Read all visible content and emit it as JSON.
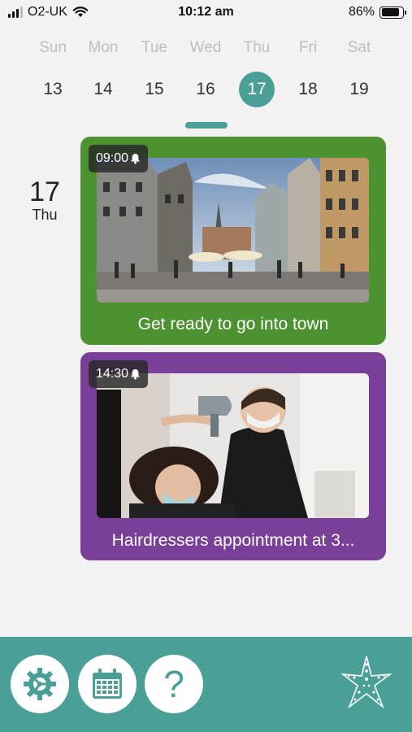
{
  "status_bar": {
    "carrier": "O2-UK",
    "time": "10:12 am",
    "battery": "86%",
    "battery_level": 0.86
  },
  "week": {
    "days": [
      {
        "name": "Sun",
        "date": "13"
      },
      {
        "name": "Mon",
        "date": "14"
      },
      {
        "name": "Tue",
        "date": "15"
      },
      {
        "name": "Wed",
        "date": "16"
      },
      {
        "name": "Thu",
        "date": "17"
      },
      {
        "name": "Fri",
        "date": "18"
      },
      {
        "name": "Sat",
        "date": "19"
      }
    ],
    "selected_index": 4
  },
  "selected_date": {
    "day": "17",
    "weekday": "Thu"
  },
  "events": [
    {
      "time": "09:00",
      "title": "Get ready to go into town",
      "color": "#4d9230",
      "image": "town-square-photo"
    },
    {
      "time": "14:30",
      "title": "Hairdressers appointment at 3...",
      "color": "#7a3f98",
      "image": "hairdresser-photo"
    }
  ],
  "bottom_bar": {
    "help_label": "?",
    "accent": "#4a9f97",
    "buttons": [
      "settings-icon",
      "calendar-icon",
      "help-icon"
    ],
    "logo": "starfish-logo"
  }
}
